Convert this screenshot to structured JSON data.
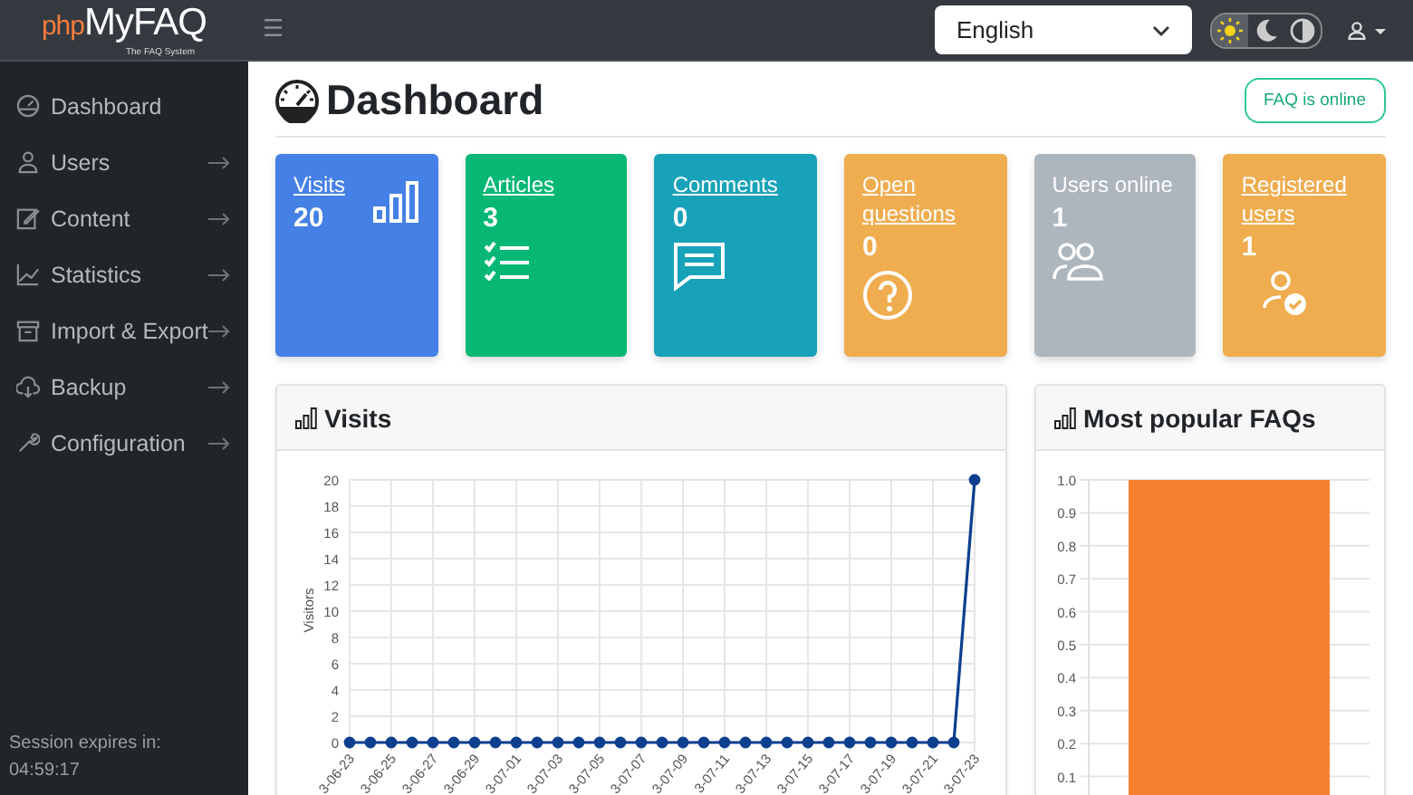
{
  "header": {
    "logo_prefix": "php",
    "logo_name": "MyFAQ",
    "logo_tagline": "The FAQ System",
    "menu_glyph": "☰",
    "language": "English",
    "theme": [
      {
        "kind": "light",
        "selected": true
      },
      {
        "kind": "dark",
        "selected": false
      },
      {
        "kind": "auto",
        "selected": false
      }
    ]
  },
  "sidebar": {
    "items": [
      {
        "kind": "gauge",
        "label": "Dashboard",
        "expandable": false
      },
      {
        "kind": "user",
        "label": "Users",
        "expandable": true
      },
      {
        "kind": "edit",
        "label": "Content",
        "expandable": true
      },
      {
        "kind": "graph",
        "label": "Statistics",
        "expandable": true
      },
      {
        "kind": "archive",
        "label": "Import & Export",
        "expandable": true
      },
      {
        "kind": "cloud",
        "label": "Backup",
        "expandable": true
      },
      {
        "kind": "wrench",
        "label": "Configuration",
        "expandable": true
      }
    ],
    "session_label": "Session expires in:",
    "session_time": "04:59:17"
  },
  "page": {
    "title": "Dashboard",
    "status": "FAQ is online"
  },
  "cards": [
    {
      "label": "Visits",
      "value": "20",
      "link": true,
      "kind": "bars",
      "color": "#4580e6"
    },
    {
      "label": "Articles",
      "value": "3",
      "link": true,
      "kind": "list",
      "color": "#06b873"
    },
    {
      "label": "Comments",
      "value": "0",
      "link": true,
      "kind": "chat",
      "color": "#18a2b9"
    },
    {
      "label": "Open questions",
      "value": "0",
      "link": true,
      "kind": "question",
      "color": "#efad4f"
    },
    {
      "label": "Users online",
      "value": "1",
      "link": false,
      "kind": "people",
      "color": "#adb5bd"
    },
    {
      "label": "Registered users",
      "value": "1",
      "link": true,
      "kind": "usercheck",
      "color": "#efad4f"
    }
  ],
  "visits_panel": {
    "title": "Visits",
    "chart_data": {
      "type": "line",
      "ylabel": "Visitors",
      "ylim": [
        0,
        20
      ],
      "yticks": [
        0,
        2,
        4,
        6,
        8,
        10,
        12,
        14,
        16,
        18,
        20
      ],
      "grid": true,
      "categories": [
        "3-06-23",
        null,
        "3-06-25",
        null,
        "3-06-27",
        null,
        "3-06-29",
        null,
        "3-07-01",
        null,
        "3-07-03",
        null,
        "3-07-05",
        null,
        "3-07-07",
        null,
        "3-07-09",
        null,
        "3-07-11",
        null,
        "3-07-13",
        null,
        "3-07-15",
        null,
        "3-07-17",
        null,
        "3-07-19",
        null,
        "3-07-21",
        null,
        "3-07-23"
      ],
      "series": [
        {
          "color": "#0d3f8f",
          "marker": "circle",
          "values": [
            0,
            0,
            0,
            0,
            0,
            0,
            0,
            0,
            0,
            0,
            0,
            0,
            0,
            0,
            0,
            0,
            0,
            0,
            0,
            0,
            0,
            0,
            0,
            0,
            0,
            0,
            0,
            0,
            0,
            0,
            20
          ]
        }
      ]
    }
  },
  "popular_panel": {
    "title": "Most popular FAQs",
    "chart_data": {
      "type": "bar",
      "grid": true,
      "ylim": [
        0,
        1
      ],
      "yticks": [
        {
          "value": 0.1,
          "label": "0.1"
        },
        {
          "value": 0.2,
          "label": "0.2"
        },
        {
          "value": 0.3,
          "label": "0.3"
        },
        {
          "value": 0.4,
          "label": "0.4"
        },
        {
          "value": 0.5,
          "label": "0.5"
        },
        {
          "value": 0.6,
          "label": "0.6"
        },
        {
          "value": 0.7,
          "label": "0.7"
        },
        {
          "value": 0.8,
          "label": "0.8"
        },
        {
          "value": 0.9,
          "label": "0.9"
        },
        {
          "value": 1.0,
          "label": "1.0"
        }
      ],
      "series": [
        {
          "color": "#f7802f",
          "values": [
            1
          ]
        }
      ]
    }
  }
}
